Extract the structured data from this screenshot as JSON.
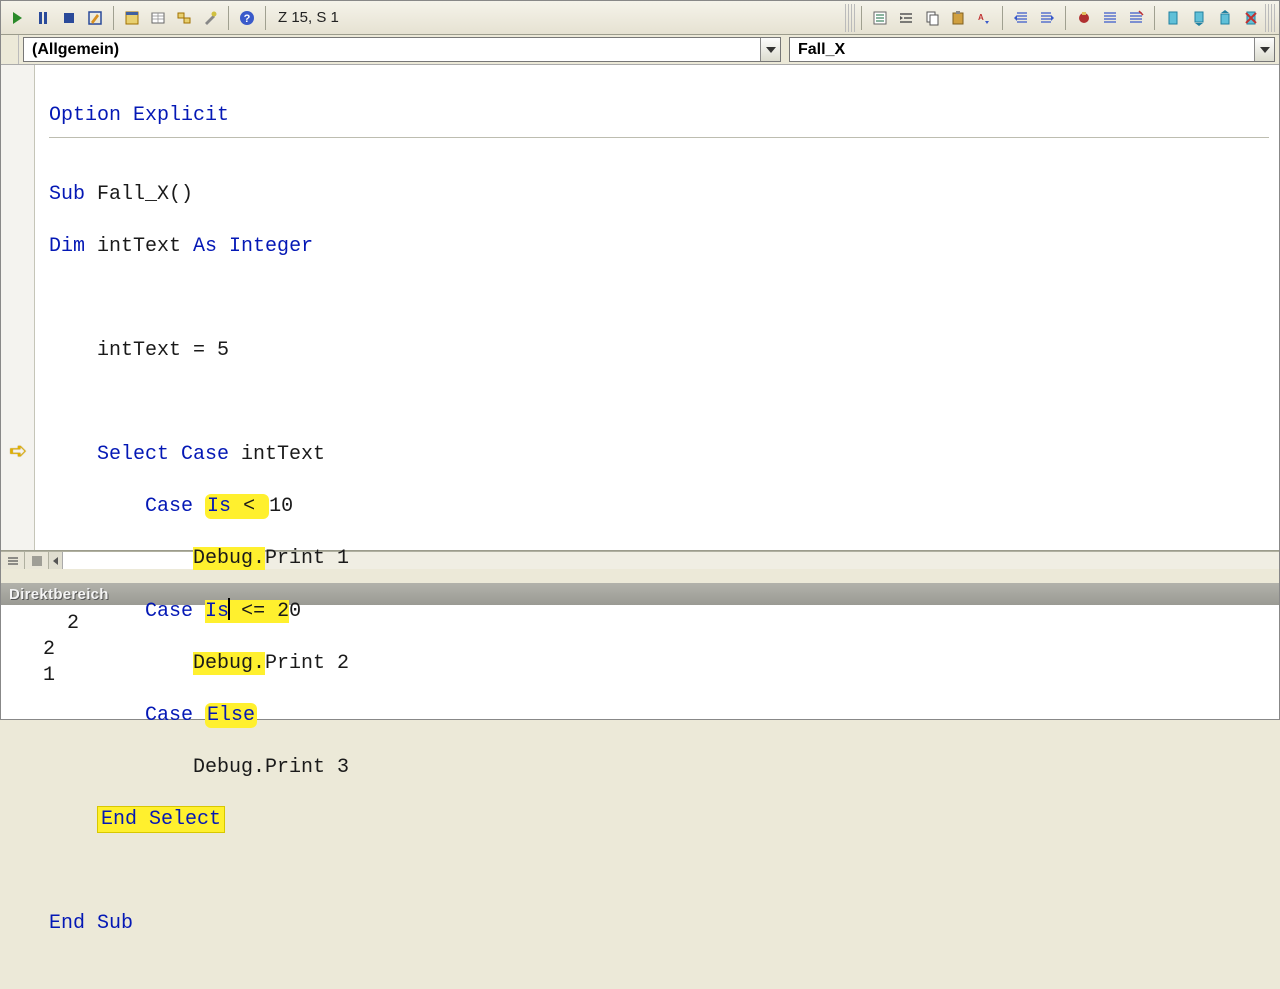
{
  "toolbar": {
    "cursor_pos": "Z 15, S 1"
  },
  "dropdowns": {
    "scope": "(Allgemein)",
    "proc": "Fall_X"
  },
  "code": {
    "option_line": "Option Explicit",
    "sub_sig": "Sub Fall_X()",
    "dim_line": "Dim intText As Integer",
    "assign": "intText = 5",
    "select_open": "Select Case intText",
    "case1": {
      "prefix": "Case ",
      "kw": "Is",
      "op": " < ",
      "val": "10"
    },
    "dbg1": "Debug.Print 1",
    "case2": {
      "prefix": "Case ",
      "kw": "Is",
      "op": " <= ",
      "val": "20"
    },
    "dbg2": "Debug.Print 2",
    "case_else": {
      "prefix": "Case ",
      "kw": "Else"
    },
    "dbg3": "Debug.Print 3",
    "end_select": "End Select",
    "end_sub": "End Sub"
  },
  "immediate": {
    "title": "Direktbereich",
    "output": "   2\n 2\n 1"
  }
}
